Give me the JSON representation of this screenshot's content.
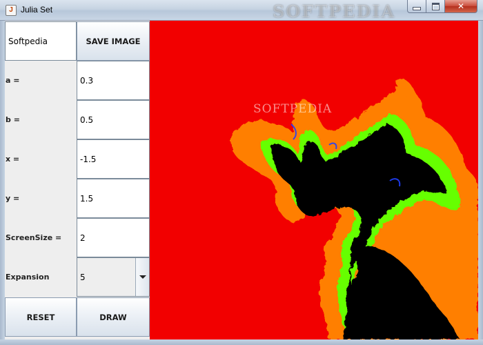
{
  "window": {
    "title": "Julia Set",
    "watermark": "SOFTPEDIA",
    "icon_glyph": "J",
    "close_glyph": "✕"
  },
  "panel": {
    "text_field_value": "Softpedia",
    "save_label": "SAVE IMAGE",
    "params": [
      {
        "label": "a =",
        "value": "0.3"
      },
      {
        "label": "b =",
        "value": "0.5"
      },
      {
        "label": "x =",
        "value": "-1.5"
      },
      {
        "label": "y =",
        "value": "1.5"
      },
      {
        "label": "ScreenSize =",
        "value": "2"
      }
    ],
    "expansion": {
      "label": "Expansion",
      "value": "5"
    },
    "reset_label": "RESET",
    "draw_label": "DRAW"
  },
  "canvas": {
    "watermark": "SOFTPEDIA",
    "colors": {
      "background": "#f20000",
      "outer": "#ff7f00",
      "edge1": "#7fff00",
      "edge2": "#00ff40",
      "edge3": "#2040ff",
      "interior": "#000000"
    }
  }
}
